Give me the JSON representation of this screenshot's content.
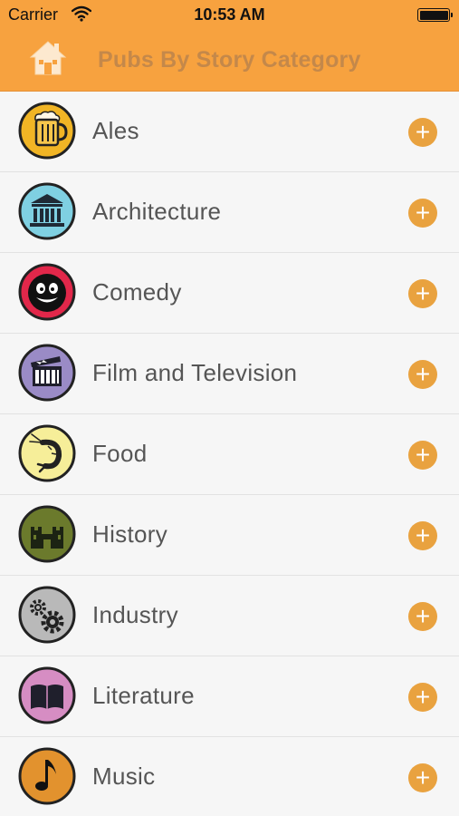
{
  "status_bar": {
    "carrier": "Carrier",
    "time": "10:53 AM"
  },
  "nav": {
    "title": "Pubs By Story Category",
    "home_icon": "home-icon"
  },
  "colors": {
    "brand_orange": "#f7a23f",
    "accent_orange": "#e9a23f",
    "text_gray": "#555555"
  },
  "categories": [
    {
      "label": "Ales",
      "icon": "beer-mug-icon",
      "badge_color": "#f1b525"
    },
    {
      "label": "Architecture",
      "icon": "temple-icon",
      "badge_color": "#7fd0e2"
    },
    {
      "label": "Comedy",
      "icon": "smiley-face-icon",
      "badge_color": "#e2274a"
    },
    {
      "label": "Film and Television",
      "icon": "clapperboard-icon",
      "badge_color": "#9a8bc6"
    },
    {
      "label": "Food",
      "icon": "shrimp-icon",
      "badge_color": "#f6ee99"
    },
    {
      "label": "History",
      "icon": "castle-icon",
      "badge_color": "#6b7a2c"
    },
    {
      "label": "Industry",
      "icon": "gears-icon",
      "badge_color": "#b9b9b9"
    },
    {
      "label": "Literature",
      "icon": "book-icon",
      "badge_color": "#d68dc3"
    },
    {
      "label": "Music",
      "icon": "music-note-icon",
      "badge_color": "#e2922e"
    }
  ],
  "row_action": {
    "glyph": "+",
    "icon": "plus-icon"
  }
}
